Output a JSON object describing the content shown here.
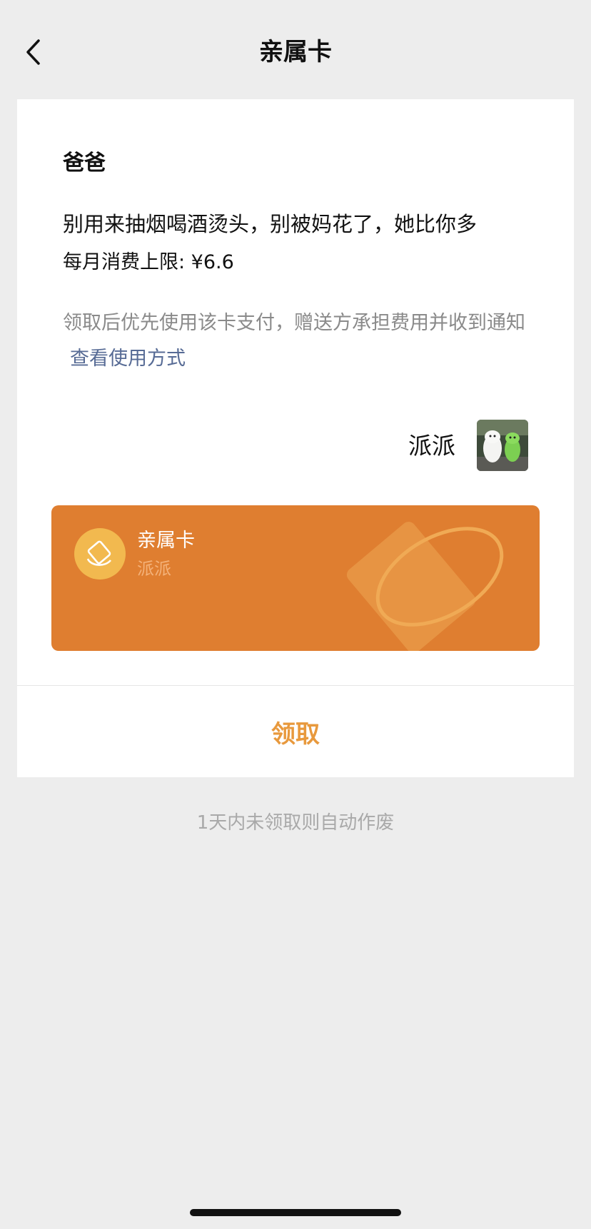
{
  "nav": {
    "title": "亲属卡",
    "back_icon": "chevron-left-icon"
  },
  "gift": {
    "recipient": "爸爸",
    "message": "别用来抽烟喝酒烫头，别被妈花了，她比你多",
    "limit_text": "每月消费上限: ¥6.6",
    "note": "领取后优先使用该卡支付，赠送方承担费用并收到通知",
    "note_link": "查看使用方式",
    "sender_name": "派派"
  },
  "card": {
    "title": "亲属卡",
    "subtitle": "派派",
    "logo_icon": "family-card-logo-icon",
    "colors": {
      "background": "#df7e30",
      "logo": "#f2b94f"
    }
  },
  "action": {
    "claim_label": "领取",
    "color": "#e8993d"
  },
  "footer": {
    "expire_tip": "1天内未领取则自动作废"
  }
}
